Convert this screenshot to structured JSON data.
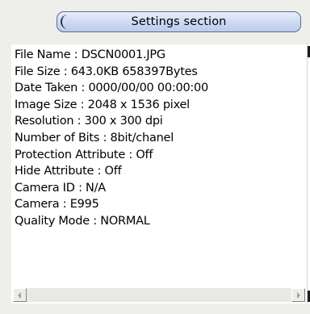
{
  "section": {
    "title": "Settings section"
  },
  "file_info": {
    "lines": [
      "File Name : DSCN0001.JPG",
      "File Size : 643.0KB 658397Bytes",
      "Date Taken : 0000/00/00 00:00:00",
      "Image Size : 2048 x 1536 pixel",
      "Resolution : 300 x 300 dpi",
      "Number of Bits : 8bit/chanel",
      "Protection Attribute : Off",
      "Hide Attribute : Off",
      "Camera ID : N/A",
      "Camera : E995",
      "Quality Mode : NORMAL"
    ]
  },
  "scrollbar": {
    "left_icon": "left-arrow-icon",
    "right_icon": "right-arrow-icon"
  },
  "colors": {
    "header_border": "#5a6e8e",
    "header_fill": "#cdd9f2",
    "panel_bg": "#ffffff",
    "window_bg": "#eeeeea"
  }
}
